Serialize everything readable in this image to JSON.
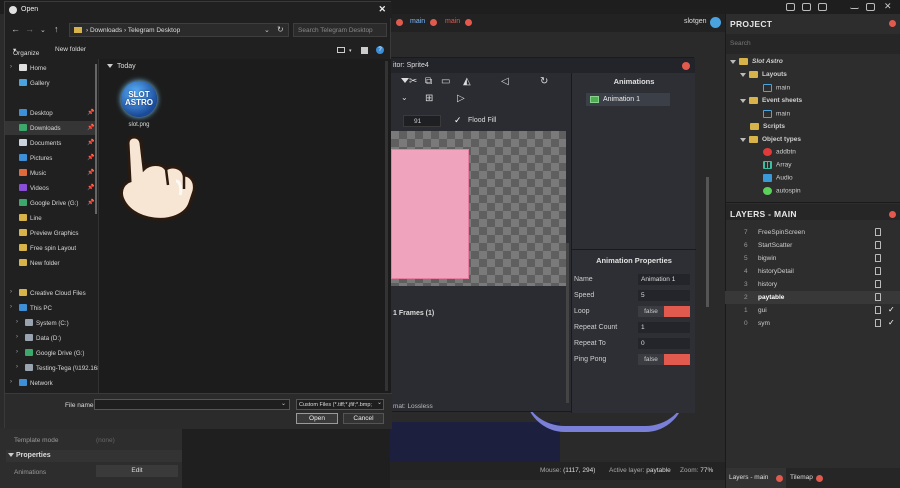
{
  "editor": {
    "tabs": [
      {
        "label": "main"
      },
      {
        "label": "main"
      }
    ],
    "user": "slotgen",
    "status": {
      "mouse_label": "Mouse:",
      "mouse_value": "(1117, 294)",
      "active_layer_label": "Active layer:",
      "active_layer_value": "paytable",
      "zoom_label": "Zoom:",
      "zoom_value": "77%"
    },
    "left_panel": {
      "template_mode_label": "Template mode",
      "template_mode_value": "(none)",
      "properties_title": "Properties",
      "animations_label": "Animations",
      "edit_button": "Edit"
    }
  },
  "project": {
    "title": "PROJECT",
    "search_placeholder": "Search",
    "root": "Slot Astro",
    "layouts_folder": "Layouts",
    "layouts": [
      "main"
    ],
    "event_sheets_folder": "Event sheets",
    "event_sheets": [
      "main"
    ],
    "scripts_folder": "Scripts",
    "object_types_folder": "Object types",
    "objects": [
      "addbtn",
      "Array",
      "Audio",
      "autospin"
    ]
  },
  "layers": {
    "title": "LAYERS - MAIN",
    "items": [
      {
        "num": "7",
        "name": "FreeSpinScreen",
        "visible": false,
        "selected": false
      },
      {
        "num": "6",
        "name": "StartScatter",
        "visible": false,
        "selected": false
      },
      {
        "num": "5",
        "name": "bigwin",
        "visible": false,
        "selected": false
      },
      {
        "num": "4",
        "name": "historyDetail",
        "visible": false,
        "selected": false
      },
      {
        "num": "3",
        "name": "history",
        "visible": false,
        "selected": false
      },
      {
        "num": "2",
        "name": "paytable",
        "visible": false,
        "selected": true
      },
      {
        "num": "1",
        "name": "gui",
        "visible": true,
        "selected": false
      },
      {
        "num": "0",
        "name": "sym",
        "visible": true,
        "selected": false
      }
    ],
    "bottom_tabs": [
      "Layers - main",
      "Tilemap"
    ]
  },
  "anim_editor": {
    "title": "itor: Sprite4",
    "zoom_value": "91",
    "flood_fill": "Flood Fill",
    "frames_label": "1 Frames (1)",
    "format_label": "mat: Lossless",
    "animations_title": "Animations",
    "animation_item": "Animation 1",
    "properties_title": "Animation Properties",
    "props": [
      {
        "key": "Name",
        "value": "Animation 1"
      },
      {
        "key": "Speed",
        "value": "5"
      },
      {
        "key": "Loop",
        "value": "false"
      },
      {
        "key": "Repeat Count",
        "value": "1"
      },
      {
        "key": "Repeat To",
        "value": "0"
      },
      {
        "key": "Ping Pong",
        "value": "false"
      }
    ]
  },
  "dialog": {
    "title": "Open",
    "address": [
      "Downloads",
      "Telegram Desktop"
    ],
    "search_placeholder": "Search Telegram Desktop",
    "organize": "Organize",
    "new_folder": "New folder",
    "sidebar": {
      "quick": [
        {
          "label": "Home",
          "icon": "home-icon",
          "color": "#e0e0e0"
        },
        {
          "label": "Gallery",
          "icon": "gallery-icon",
          "color": "#4aa3df"
        }
      ],
      "pinned": [
        {
          "label": "Desktop",
          "icon": "desktop-icon",
          "color": "#3d8fd8"
        },
        {
          "label": "Downloads",
          "icon": "downloads-icon",
          "color": "#3da86b"
        },
        {
          "label": "Documents",
          "icon": "documents-icon",
          "color": "#c9d3dd"
        },
        {
          "label": "Pictures",
          "icon": "pictures-icon",
          "color": "#3d8fd8"
        },
        {
          "label": "Music",
          "icon": "music-icon",
          "color": "#e06a3a"
        },
        {
          "label": "Videos",
          "icon": "videos-icon",
          "color": "#8a4fd8"
        },
        {
          "label": "Google Drive (G:)",
          "icon": "google-drive-icon",
          "color": "#3da86b"
        },
        {
          "label": "Line",
          "icon": "folder-icon",
          "color": "#d8b34a"
        },
        {
          "label": "Preview Graphics",
          "icon": "folder-icon",
          "color": "#d8b34a"
        },
        {
          "label": "Free spin Layout",
          "icon": "folder-icon",
          "color": "#d8b34a"
        },
        {
          "label": "New folder",
          "icon": "folder-icon",
          "color": "#d8b34a"
        }
      ],
      "cloud": "Creative Cloud Files",
      "this_pc": "This PC",
      "drives": [
        "System (C:)",
        "Data (D:)",
        "Google Drive (G:)",
        "Testing-Tega (\\\\192.168."
      ],
      "network": "Network"
    },
    "group_label": "Today",
    "file": {
      "name": "slot.png",
      "thumb_text_1": "SLOT",
      "thumb_text_2": "ASTRO"
    },
    "file_name_label": "File name:",
    "file_type": "Custom Files (*.tiff;*.jfif;*.bmp;",
    "open_button": "Open",
    "cancel_button": "Cancel"
  }
}
